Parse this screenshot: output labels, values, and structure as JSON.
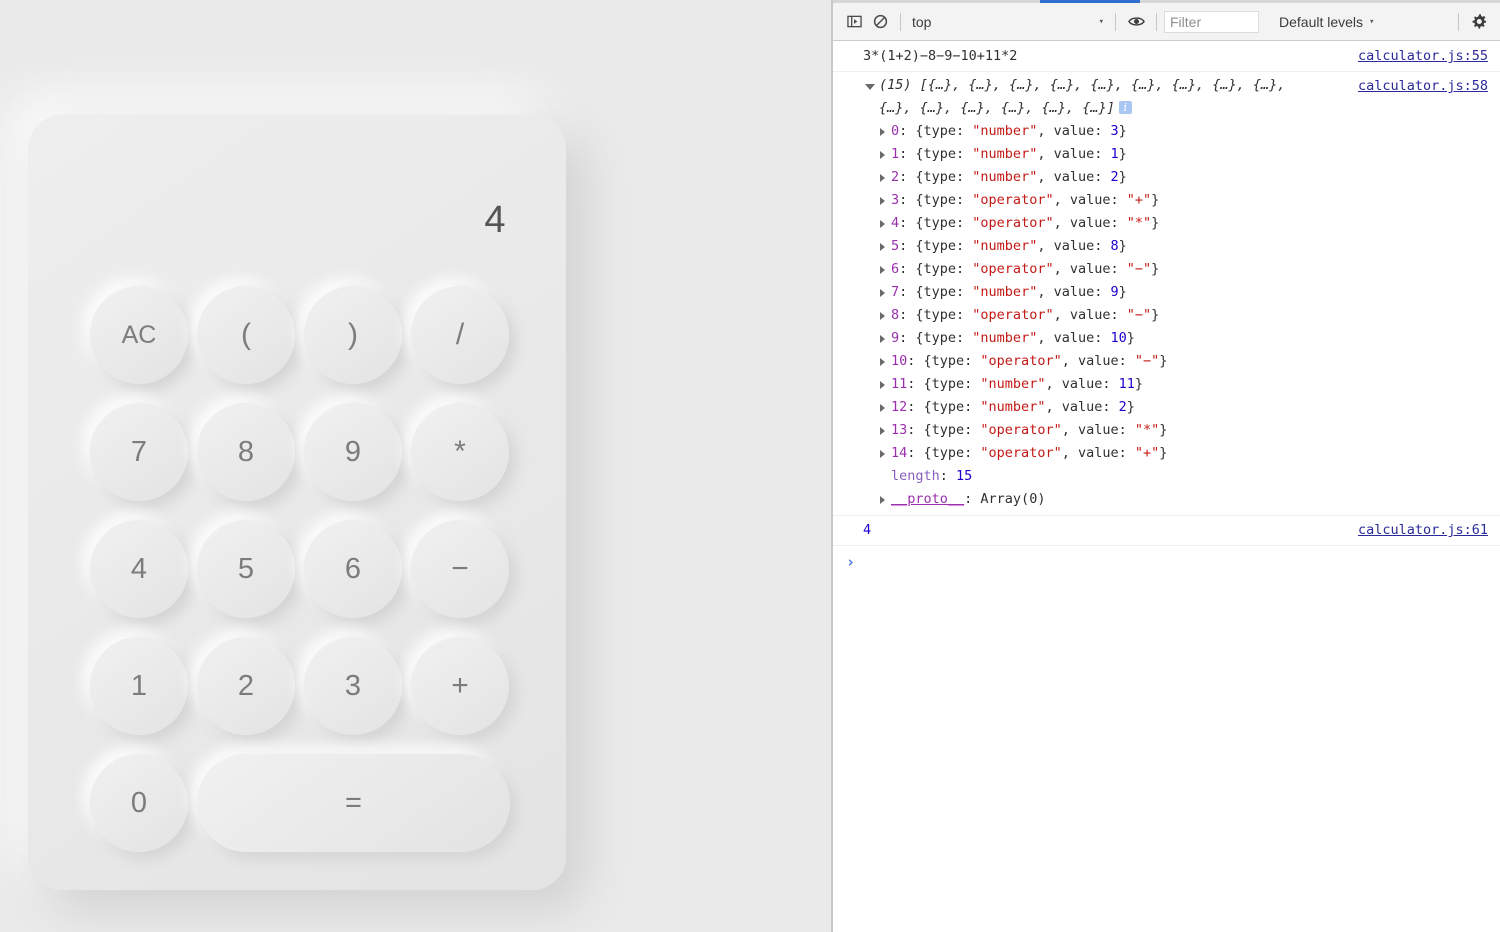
{
  "calculator": {
    "display_value": "4",
    "rows": [
      [
        {
          "label": "AC",
          "name": "key-ac",
          "kind": "small"
        },
        {
          "label": "(",
          "name": "key-open-paren",
          "kind": "op"
        },
        {
          "label": ")",
          "name": "key-close-paren",
          "kind": "op"
        },
        {
          "label": "/",
          "name": "key-divide",
          "kind": "op"
        }
      ],
      [
        {
          "label": "7",
          "name": "key-7",
          "kind": "num"
        },
        {
          "label": "8",
          "name": "key-8",
          "kind": "num"
        },
        {
          "label": "9",
          "name": "key-9",
          "kind": "num"
        },
        {
          "label": "*",
          "name": "key-multiply",
          "kind": "op"
        }
      ],
      [
        {
          "label": "4",
          "name": "key-4",
          "kind": "num"
        },
        {
          "label": "5",
          "name": "key-5",
          "kind": "num"
        },
        {
          "label": "6",
          "name": "key-6",
          "kind": "num"
        },
        {
          "label": "−",
          "name": "key-subtract",
          "kind": "op"
        }
      ],
      [
        {
          "label": "1",
          "name": "key-1",
          "kind": "num"
        },
        {
          "label": "2",
          "name": "key-2",
          "kind": "num"
        },
        {
          "label": "3",
          "name": "key-3",
          "kind": "num"
        },
        {
          "label": "+",
          "name": "key-add",
          "kind": "op"
        }
      ],
      [
        {
          "label": "0",
          "name": "key-0",
          "kind": "num"
        },
        {
          "label": "=",
          "name": "key-equals",
          "kind": "equals"
        }
      ]
    ]
  },
  "devtools": {
    "toolbar": {
      "sidebar_toggle_icon": "sidebar-toggle-icon",
      "clear_console_icon": "clear-console-icon",
      "context_value": "top",
      "context_caret": "▾",
      "eye_icon": "eye-icon",
      "filter_placeholder": "Filter",
      "filter_value": "",
      "levels_label": "Default levels",
      "levels_caret": "▾",
      "settings_icon": "gear-icon"
    },
    "messages": [
      {
        "kind": "log",
        "text": "3*(1+2)−8−9−10+11*2",
        "source": "calculator.js:55"
      },
      {
        "kind": "object",
        "source": "calculator.js:58",
        "summary_count": "(15)",
        "summary_body": "[{…}, {…}, {…}, {…}, {…}, {…}, {…}, {…}, {…}, {…}, {…}, {…}, {…}, {…}, {…}]",
        "info_badge": "i",
        "properties": [
          {
            "index": "0",
            "type": "\"number\"",
            "value": "3",
            "value_kind": "num"
          },
          {
            "index": "1",
            "type": "\"number\"",
            "value": "1",
            "value_kind": "num"
          },
          {
            "index": "2",
            "type": "\"number\"",
            "value": "2",
            "value_kind": "num"
          },
          {
            "index": "3",
            "type": "\"operator\"",
            "value": "\"+\"",
            "value_kind": "str"
          },
          {
            "index": "4",
            "type": "\"operator\"",
            "value": "\"*\"",
            "value_kind": "str"
          },
          {
            "index": "5",
            "type": "\"number\"",
            "value": "8",
            "value_kind": "num"
          },
          {
            "index": "6",
            "type": "\"operator\"",
            "value": "\"−\"",
            "value_kind": "str"
          },
          {
            "index": "7",
            "type": "\"number\"",
            "value": "9",
            "value_kind": "num"
          },
          {
            "index": "8",
            "type": "\"operator\"",
            "value": "\"−\"",
            "value_kind": "str"
          },
          {
            "index": "9",
            "type": "\"number\"",
            "value": "10",
            "value_kind": "num"
          },
          {
            "index": "10",
            "type": "\"operator\"",
            "value": "\"−\"",
            "value_kind": "str"
          },
          {
            "index": "11",
            "type": "\"number\"",
            "value": "11",
            "value_kind": "num"
          },
          {
            "index": "12",
            "type": "\"number\"",
            "value": "2",
            "value_kind": "num"
          },
          {
            "index": "13",
            "type": "\"operator\"",
            "value": "\"*\"",
            "value_kind": "str"
          },
          {
            "index": "14",
            "type": "\"operator\"",
            "value": "\"+\"",
            "value_kind": "str"
          }
        ],
        "length_key": "length",
        "length_value": "15",
        "proto_key": "__proto__",
        "proto_value": "Array(0)"
      },
      {
        "kind": "result",
        "text": "4",
        "source": "calculator.js:61"
      }
    ],
    "prompt_caret": "›"
  },
  "colors": {
    "accent_blue": "#2f6fd0",
    "string_red": "#c41a16",
    "number_blue": "#1c00cf",
    "index_purple": "#9b2fae",
    "link_navy": "#2a2a9a",
    "page_bg": "#eaeaea"
  }
}
